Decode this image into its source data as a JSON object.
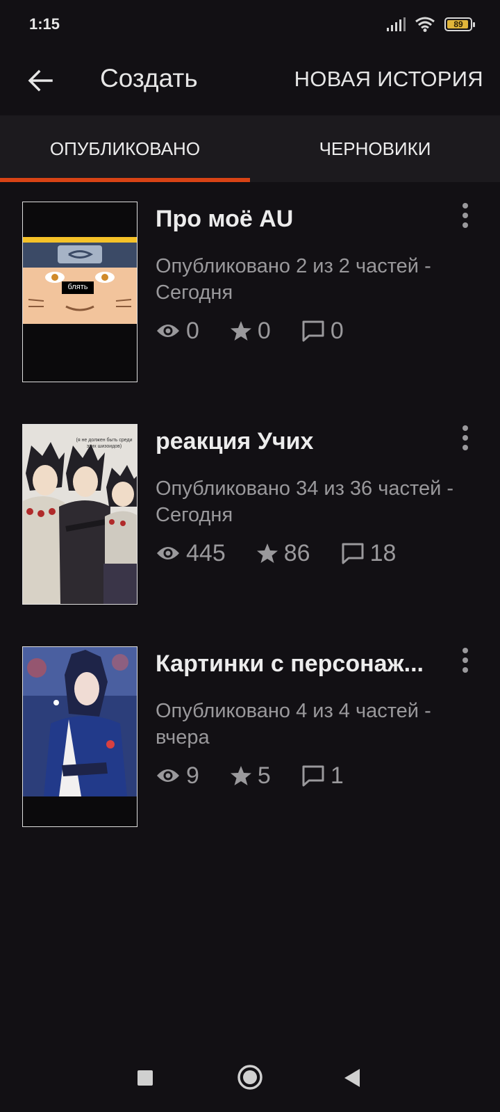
{
  "status_bar": {
    "time": "1:15",
    "battery_level": "89",
    "icons": [
      "signal-icon",
      "wifi-icon",
      "battery-icon"
    ]
  },
  "app_bar": {
    "title": "Создать",
    "action_label": "НОВАЯ ИСТОРИЯ",
    "back_icon": "arrow-left-icon"
  },
  "tabs": [
    {
      "label": "ОПУБЛИКОВАНО",
      "selected": true
    },
    {
      "label": "ЧЕРНОВИКИ",
      "selected": false
    }
  ],
  "colors": {
    "accent": "#d84315",
    "background": "#121014",
    "tab_background": "#1c1a1e",
    "secondary_text": "#9a999c"
  },
  "stories": [
    {
      "title": "Про моё AU",
      "meta": "Опубликовано 2 из 2 частей - Сегодня",
      "views": "0",
      "votes": "0",
      "comments": "0",
      "cover_caption": "блять"
    },
    {
      "title": "реакция Учих",
      "meta": "Опубликовано 34 из 36 частей - Сегодня",
      "views": "445",
      "votes": "86",
      "comments": "18",
      "cover_caption": "(я не должен быть среди этих шизоидов)"
    },
    {
      "title": "Картинки с персонаж...",
      "meta": "Опубликовано 4 из 4 частей - вчера",
      "views": "9",
      "votes": "5",
      "comments": "1",
      "cover_caption": ""
    }
  ],
  "nav_bar": {
    "icons": [
      "recents-square-icon",
      "home-circle-icon",
      "back-triangle-icon"
    ]
  }
}
